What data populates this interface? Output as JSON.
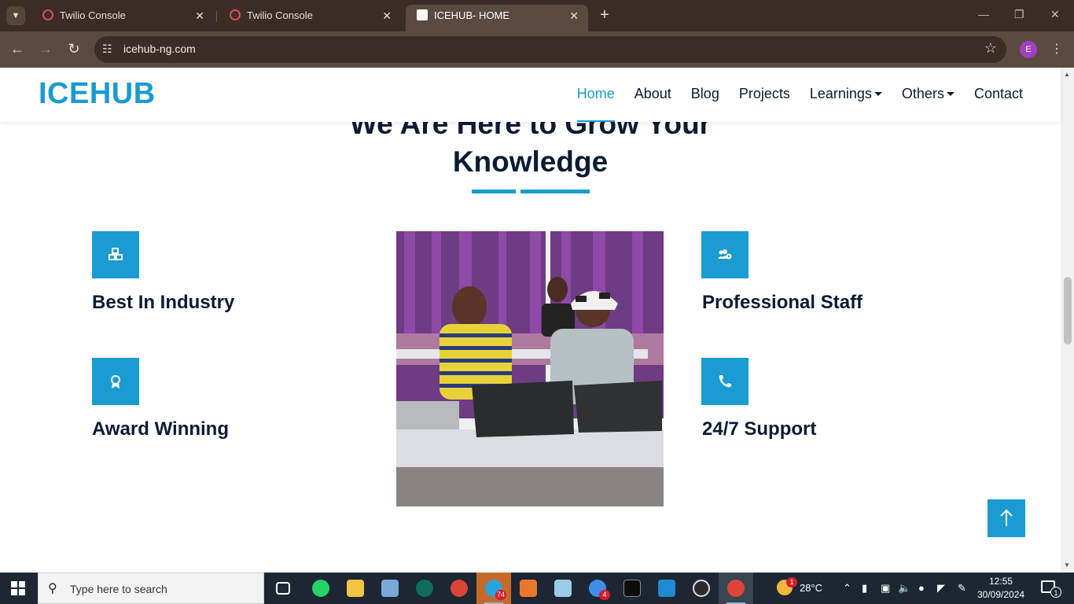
{
  "browser": {
    "tabs": [
      {
        "title": "Twilio Console",
        "active": false
      },
      {
        "title": "Twilio Console",
        "active": false
      },
      {
        "title": "ICEHUB- HOME",
        "active": true
      }
    ],
    "url": "icehub-ng.com",
    "profile_initial": "E"
  },
  "site": {
    "logo": "ICEHUB",
    "nav": [
      {
        "label": "Home",
        "active": true
      },
      {
        "label": "About"
      },
      {
        "label": "Blog"
      },
      {
        "label": "Projects"
      },
      {
        "label": "Learnings",
        "dropdown": true
      },
      {
        "label": "Others",
        "dropdown": true
      },
      {
        "label": "Contact"
      }
    ],
    "heading_line1": "We Are Here to Grow Your",
    "heading_line2": "Knowledge",
    "features": [
      {
        "title": "Best In Industry",
        "icon": "cubes-icon"
      },
      {
        "title": "Professional Staff",
        "icon": "users-cog-icon"
      },
      {
        "title": "Award Winning",
        "icon": "award-icon"
      },
      {
        "title": "24/7 Support",
        "icon": "phone-icon"
      }
    ],
    "accent_color": "#1a9bd1",
    "heading_color": "#0b1c33"
  },
  "taskbar": {
    "search_placeholder": "Type here to search",
    "telegram_badge": "74",
    "app_badge": "4",
    "temperature": "28°C",
    "weather_badge": "1",
    "time": "12:55",
    "date": "30/09/2024",
    "notifications": "1"
  }
}
